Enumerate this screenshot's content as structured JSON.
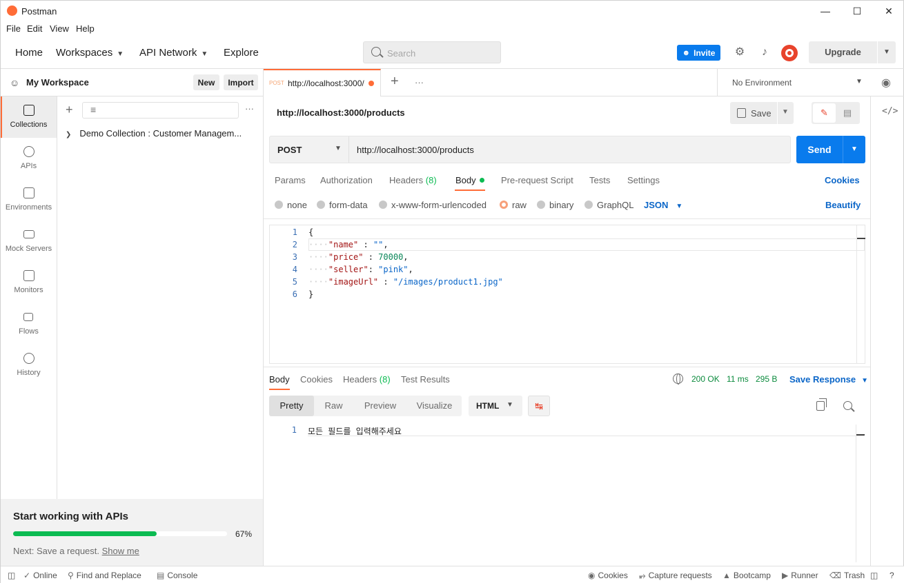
{
  "app": {
    "title": "Postman"
  },
  "menu": [
    "File",
    "Edit",
    "View",
    "Help"
  ],
  "window_controls": {
    "minimize": "—",
    "maximize": "☐",
    "close": "✕"
  },
  "header": {
    "home": "Home",
    "workspaces": "Workspaces",
    "api_network": "API Network",
    "explore": "Explore",
    "search_placeholder": "Search",
    "invite": "Invite",
    "upgrade": "Upgrade"
  },
  "workspace": {
    "name": "My Workspace",
    "new": "New",
    "import": "Import"
  },
  "rail": [
    {
      "label": "Collections",
      "icon": "collections-icon"
    },
    {
      "label": "APIs",
      "icon": "apis-icon"
    },
    {
      "label": "Environments",
      "icon": "environments-icon"
    },
    {
      "label": "Mock Servers",
      "icon": "mock-servers-icon"
    },
    {
      "label": "Monitors",
      "icon": "monitors-icon"
    },
    {
      "label": "Flows",
      "icon": "flows-icon"
    },
    {
      "label": "History",
      "icon": "history-icon"
    }
  ],
  "collections": [
    {
      "name": "Demo Collection : Customer Managem..."
    }
  ],
  "onboarding": {
    "title": "Start working with APIs",
    "progress_percent": 67,
    "progress_label": "67%",
    "next_prefix": "Next: Save a request.",
    "show_me": "Show me"
  },
  "tab": {
    "method": "POST",
    "url": "http://localhost:3000/"
  },
  "environment": {
    "selected": "No Environment"
  },
  "request": {
    "title": "http://localhost:3000/products",
    "save": "Save",
    "method": "POST",
    "url": "http://localhost:3000/products",
    "send": "Send",
    "tabs": {
      "params": "Params",
      "authorization": "Authorization",
      "headers": "Headers",
      "headers_count": "(8)",
      "body": "Body",
      "pre_request": "Pre-request Script",
      "tests": "Tests",
      "settings": "Settings"
    },
    "cookies": "Cookies",
    "body_types": {
      "none": "none",
      "form_data": "form-data",
      "urlencoded": "x-www-form-urlencoded",
      "raw": "raw",
      "binary": "binary",
      "graphql": "GraphQL"
    },
    "raw_format": "JSON",
    "beautify": "Beautify",
    "body_lines": [
      {
        "n": "1",
        "text": "{"
      },
      {
        "n": "2",
        "key": "\"name\"",
        "sep": " : ",
        "val": "\"\"",
        "end": ","
      },
      {
        "n": "3",
        "key": "\"price\"",
        "sep": " : ",
        "val": "70000",
        "end": ","
      },
      {
        "n": "4",
        "key": "\"seller\"",
        "sep": ": ",
        "val": "\"pink\"",
        "end": ","
      },
      {
        "n": "5",
        "key": "\"imageUrl\"",
        "sep": " : ",
        "val": "\"/images/product1.jpg\"",
        "end": ""
      },
      {
        "n": "6",
        "text": "}"
      }
    ]
  },
  "response": {
    "tabs": {
      "body": "Body",
      "cookies": "Cookies",
      "headers": "Headers",
      "headers_count": "(8)",
      "test_results": "Test Results"
    },
    "status": "200 OK",
    "time": "11 ms",
    "size": "295 B",
    "save_response": "Save Response",
    "views": {
      "pretty": "Pretty",
      "raw": "Raw",
      "preview": "Preview",
      "visualize": "Visualize"
    },
    "format": "HTML",
    "line_no": "1",
    "body_text": "모든 필드를 입력해주세요"
  },
  "statusbar": {
    "online": "Online",
    "find_replace": "Find and Replace",
    "console": "Console",
    "cookies": "Cookies",
    "capture": "Capture requests",
    "bootcamp": "Bootcamp",
    "runner": "Runner",
    "trash": "Trash"
  },
  "colors": {
    "accent": "#ff6c37",
    "primary": "#097bed",
    "success": "#0cbb52",
    "link": "#0b66c8"
  }
}
